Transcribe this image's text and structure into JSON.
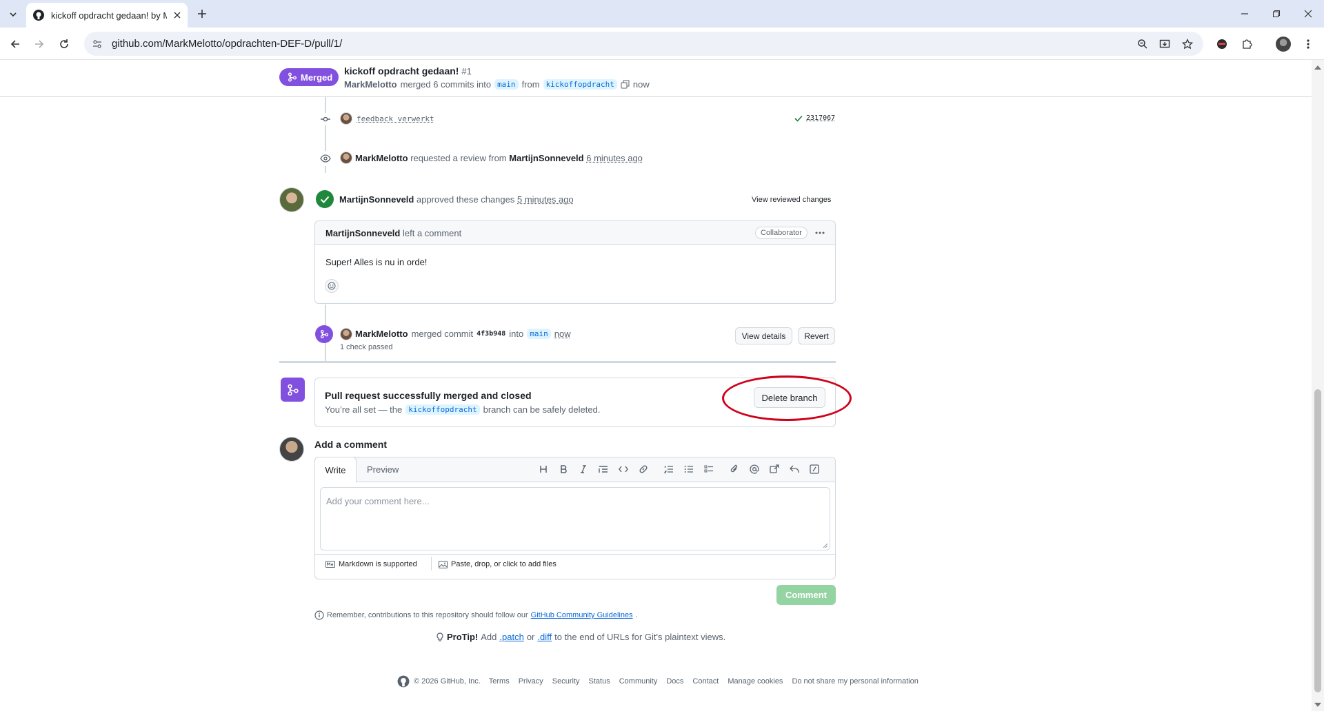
{
  "browser": {
    "tab_title": "kickoff opdracht gedaan! by Ma",
    "url": "github.com/MarkMelotto/opdrachten-DEF-D/pull/1/"
  },
  "header": {
    "status": "Merged",
    "title": "kickoff opdracht gedaan!",
    "number": "#1",
    "author": "MarkMelotto",
    "merged_text": "merged 6 commits into",
    "base_branch": "main",
    "from_text": "from",
    "head_branch": "kickoffopdracht",
    "time": "now"
  },
  "timeline": {
    "commit": {
      "message": "feedback verwerkt",
      "sha": "2317067"
    },
    "review_request": {
      "actor": "MarkMelotto",
      "text": "requested a review from",
      "reviewer": "MartijnSonneveld",
      "time": "6 minutes ago"
    },
    "approval": {
      "actor": "MartijnSonneveld",
      "text": "approved these changes",
      "time": "5 minutes ago",
      "view_label": "View reviewed changes"
    },
    "comment": {
      "author": "MartijnSonneveld",
      "text": "left a comment",
      "badge": "Collaborator",
      "body": "Super! Alles is nu in orde!"
    },
    "merge_event": {
      "actor": "MarkMelotto",
      "text": "merged commit",
      "sha": "4f3b948",
      "into": "into",
      "branch": "main",
      "time": "now",
      "checks": "1 check passed",
      "view_details": "View details",
      "revert": "Revert"
    }
  },
  "merged_box": {
    "title": "Pull request successfully merged and closed",
    "desc_pre": "You’re all set — the",
    "branch": "kickoffopdracht",
    "desc_post": "branch can be safely deleted.",
    "delete_label": "Delete branch"
  },
  "add_comment": {
    "heading": "Add a comment",
    "tab_write": "Write",
    "tab_preview": "Preview",
    "placeholder": "Add your comment here...",
    "markdown": "Markdown is supported",
    "attach": "Paste, drop, or click to add files",
    "submit": "Comment",
    "reminder_pre": "Remember, contributions to this repository should follow our",
    "reminder_link": "GitHub Community Guidelines",
    "reminder_post": "."
  },
  "protip": {
    "label": "ProTip!",
    "pre": "Add",
    "patch": ".patch",
    "or": "or",
    "diff": ".diff",
    "post": "to the end of URLs for Git's plaintext views."
  },
  "footer": {
    "copyright": "© 2026 GitHub, Inc.",
    "links": [
      "Terms",
      "Privacy",
      "Security",
      "Status",
      "Community",
      "Docs",
      "Contact",
      "Manage cookies",
      "Do not share my personal information"
    ]
  },
  "colors": {
    "merged": "#8250df",
    "success": "#1a7f37",
    "annotation": "#d0021b"
  }
}
